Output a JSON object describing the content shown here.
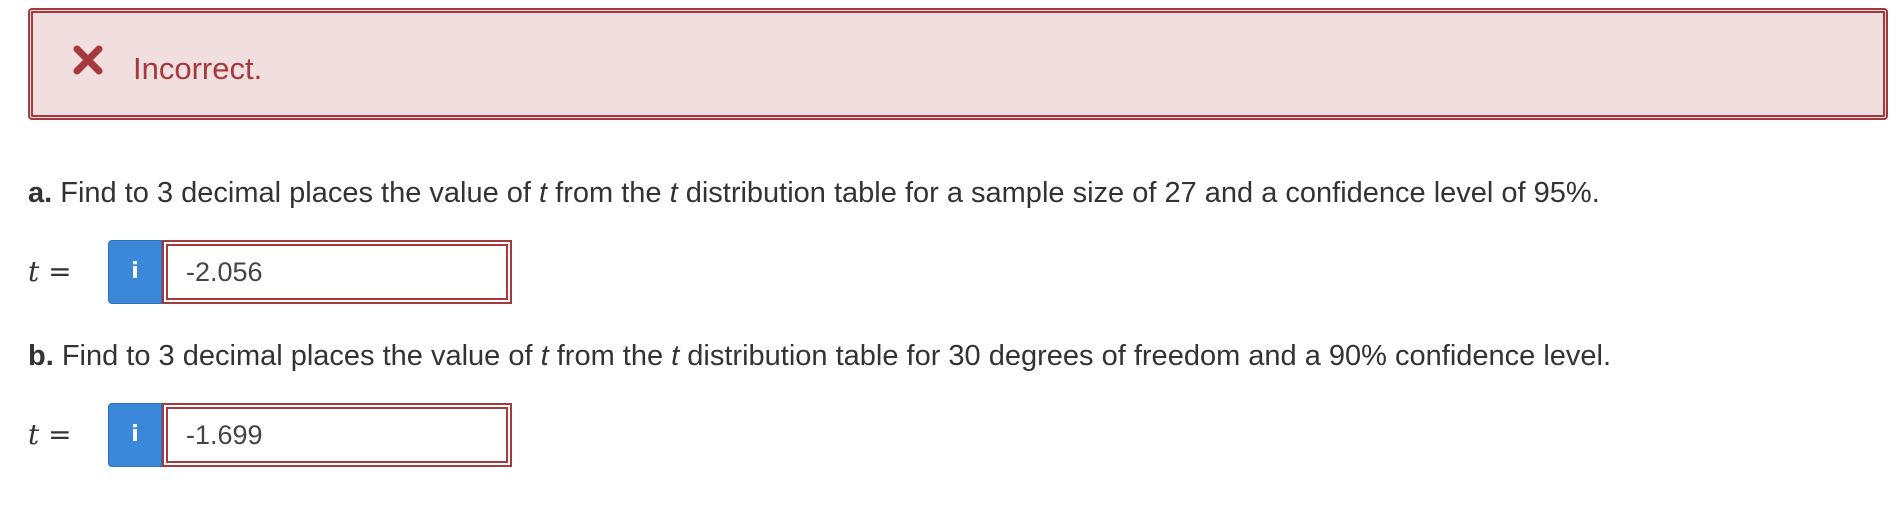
{
  "alert": {
    "icon": "close-icon",
    "message": "Incorrect.",
    "color": "#a53a3e",
    "background": "#f1dfe0"
  },
  "questions": [
    {
      "label": "a.",
      "text_1": " Find to 3 decimal places the value of ",
      "var_1": "t",
      "text_2": " from the ",
      "var_2": "t",
      "text_3": " distribution table for a sample size of 27 and a confidence level of 95%.",
      "answer_var": "t",
      "answer_eq": " =",
      "info_icon": "i",
      "answer_value": "-2.056"
    },
    {
      "label": "b.",
      "text_1": " Find to 3 decimal places the value of ",
      "var_1": "t",
      "text_2": " from the ",
      "var_2": "t",
      "text_3": " distribution table for 30 degrees of freedom and a 90% confidence level.",
      "answer_var": "t",
      "answer_eq": " =",
      "info_icon": "i",
      "answer_value": "-1.699"
    }
  ],
  "colors": {
    "info_button": "#3b87d9",
    "error_border": "#a53a3e"
  }
}
